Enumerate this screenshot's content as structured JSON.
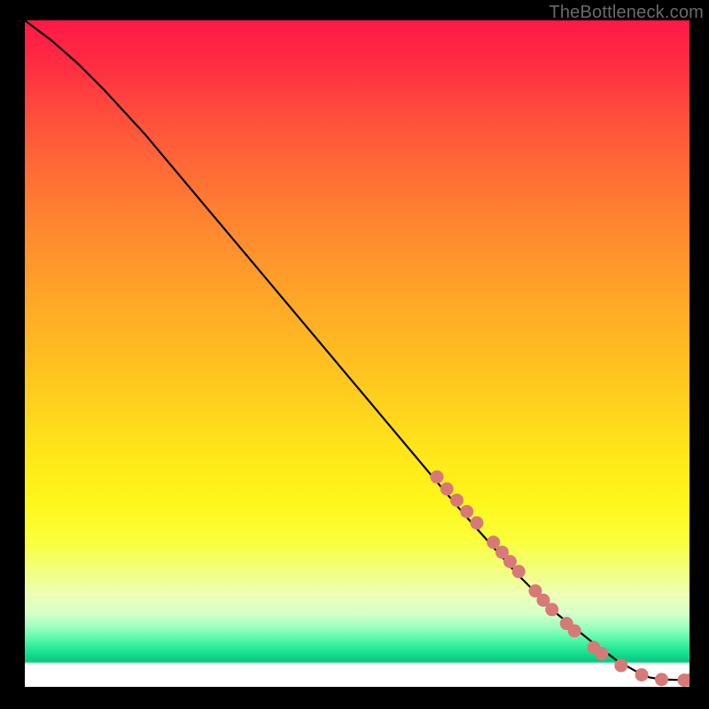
{
  "watermark": "TheBottleneck.com",
  "colors": {
    "curve": "#000000",
    "point": "#d77a77",
    "background_black": "#000000"
  },
  "chart_data": {
    "type": "line",
    "title": "",
    "xlabel": "",
    "ylabel": "",
    "xlim": [
      0,
      100
    ],
    "ylim": [
      0,
      100
    ],
    "grid": false,
    "series": [
      {
        "name": "curve",
        "x": [
          0,
          4,
          8,
          12,
          18,
          26,
          34,
          42,
          50,
          58,
          66,
          74,
          80,
          85,
          89,
          92,
          94,
          96,
          100
        ],
        "y": [
          100,
          97,
          93.5,
          89.5,
          83,
          73.5,
          64,
          54.5,
          45,
          35.5,
          26,
          17,
          11,
          7,
          4,
          2.3,
          1.4,
          1.1,
          1.0
        ]
      }
    ],
    "points": [
      {
        "x": 62,
        "y": 31.5
      },
      {
        "x": 63.5,
        "y": 29.7
      },
      {
        "x": 65,
        "y": 28
      },
      {
        "x": 66.5,
        "y": 26.3
      },
      {
        "x": 68,
        "y": 24.6
      },
      {
        "x": 70.5,
        "y": 21.7
      },
      {
        "x": 71.8,
        "y": 20.2
      },
      {
        "x": 73,
        "y": 18.8
      },
      {
        "x": 74.3,
        "y": 17.3
      },
      {
        "x": 76.8,
        "y": 14.4
      },
      {
        "x": 78,
        "y": 13
      },
      {
        "x": 79.3,
        "y": 11.6
      },
      {
        "x": 81.5,
        "y": 9.5
      },
      {
        "x": 82.7,
        "y": 8.4
      },
      {
        "x": 85.6,
        "y": 5.9
      },
      {
        "x": 86.8,
        "y": 5
      },
      {
        "x": 89.7,
        "y": 3.2
      },
      {
        "x": 92.8,
        "y": 1.8
      },
      {
        "x": 95.8,
        "y": 1.1
      },
      {
        "x": 99.2,
        "y": 1.0
      },
      {
        "x": 100,
        "y": 1.0
      }
    ]
  }
}
